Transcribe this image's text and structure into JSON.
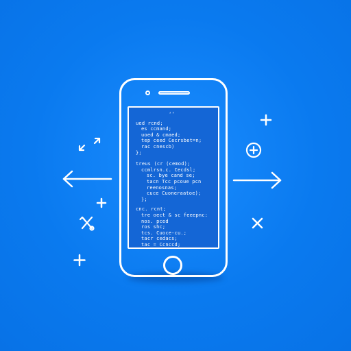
{
  "colors": {
    "background": "#0a7aef",
    "line": "#ffffff",
    "code_text": "#ffffff",
    "code_accent": "#9ee8ff"
  },
  "icons": {
    "left_arrow": "arrow-left-icon",
    "right_arrow": "arrow-right-icon",
    "plus": "plus-icon",
    "cross": "x-icon",
    "circle_plus": "circle-plus-icon",
    "tools": "crossed-tools-icon",
    "expand": "expand-arrows-icon"
  },
  "code_lines": [
    {
      "indent": 0,
      "text": "‘’"
    },
    {
      "indent": 0,
      "text": "ued rcnd;"
    },
    {
      "indent": 1,
      "text": "es  ccmand;"
    },
    {
      "indent": 1,
      "text": "uoed  &  cmaed;"
    },
    {
      "indent": 1,
      "text": "tep  ceed  Cecrsbet=n;"
    },
    {
      "indent": 1,
      "text": "rac  cnescb)"
    },
    {
      "indent": 0,
      "text": "};"
    },
    {
      "indent": 0,
      "text": "treus  (cr  (cemod);"
    },
    {
      "indent": 1,
      "text": "ccmlrsn.c.  Cecdsl;"
    },
    {
      "indent": 2,
      "text": "sc.  bye  cand  se;"
    },
    {
      "indent": 2,
      "text": "tacn  Tcc  pcoue  pcn"
    },
    {
      "indent": 2,
      "text": "reenosnas;"
    },
    {
      "indent": 2,
      "text": "cuce  Cuoneraatoe);"
    },
    {
      "indent": 1,
      "text": "};"
    },
    {
      "indent": 0,
      "text": "cnc.  rcnt;"
    },
    {
      "indent": 1,
      "text": "tre  oect  &  sc  feeepnc:"
    },
    {
      "indent": 1,
      "text": "nos.  pced"
    },
    {
      "indent": 1,
      "text": "ros  shc;"
    },
    {
      "indent": 1,
      "text": "tcs.  Cuoce-cu.;"
    },
    {
      "indent": 1,
      "text": "tacr  cedacs;"
    },
    {
      "indent": 1,
      "text": "tac  =  Ccnccd;"
    },
    {
      "indent": 0,
      "text": "};"
    }
  ]
}
